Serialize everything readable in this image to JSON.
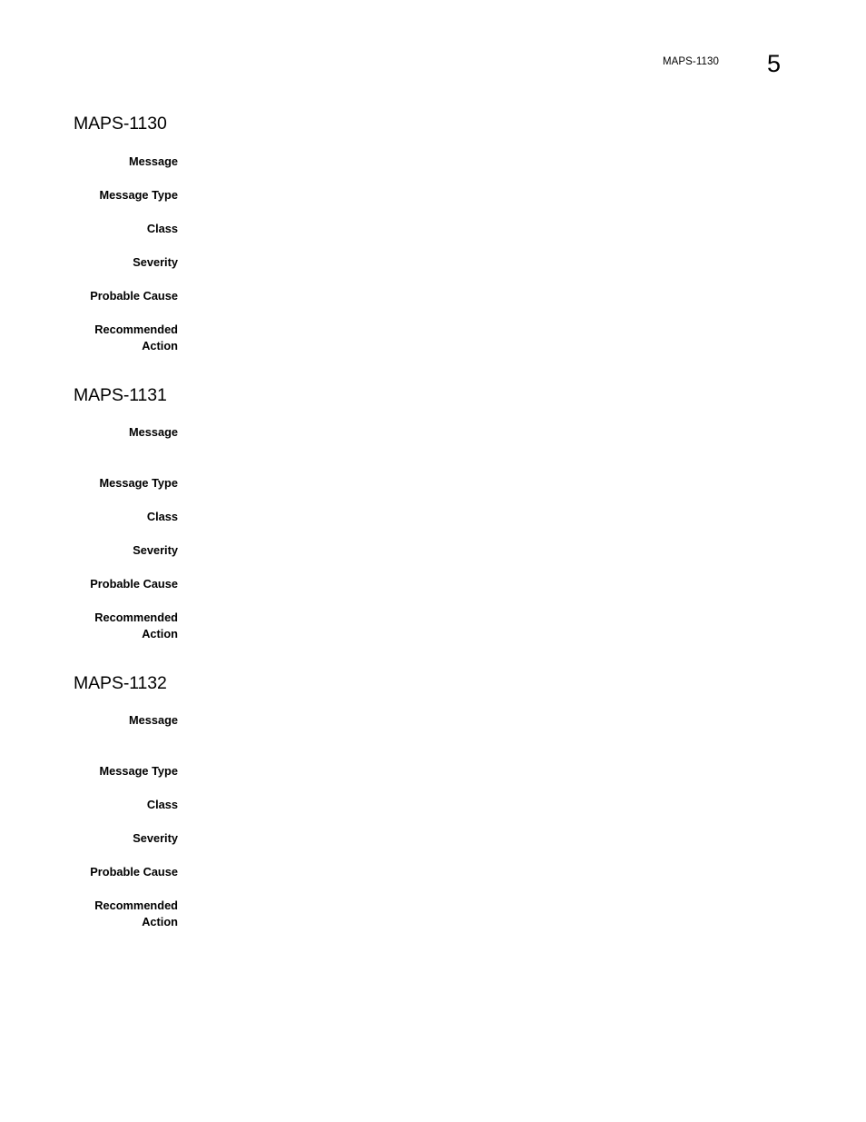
{
  "header": {
    "reference": "MAPS-1130",
    "page_number": "5"
  },
  "colors": {
    "page_background": "#ffffff",
    "text": "#000000"
  },
  "sections": [
    {
      "title": "MAPS-1130",
      "fields": [
        {
          "label": "Message",
          "value": ""
        },
        {
          "label": "Message Type",
          "value": ""
        },
        {
          "label": "Class",
          "value": ""
        },
        {
          "label": "Severity",
          "value": ""
        },
        {
          "label": "Probable Cause",
          "value": ""
        },
        {
          "label": "Recommended\nAction",
          "value": ""
        }
      ]
    },
    {
      "title": "MAPS-1131",
      "fields": [
        {
          "label": "Message",
          "value": ""
        },
        {
          "label": "Message Type",
          "value": ""
        },
        {
          "label": "Class",
          "value": ""
        },
        {
          "label": "Severity",
          "value": ""
        },
        {
          "label": "Probable Cause",
          "value": ""
        },
        {
          "label": "Recommended\nAction",
          "value": ""
        }
      ]
    },
    {
      "title": "MAPS-1132",
      "fields": [
        {
          "label": "Message",
          "value": ""
        },
        {
          "label": "Message Type",
          "value": ""
        },
        {
          "label": "Class",
          "value": ""
        },
        {
          "label": "Severity",
          "value": ""
        },
        {
          "label": "Probable Cause",
          "value": ""
        },
        {
          "label": "Recommended\nAction",
          "value": ""
        }
      ]
    }
  ]
}
